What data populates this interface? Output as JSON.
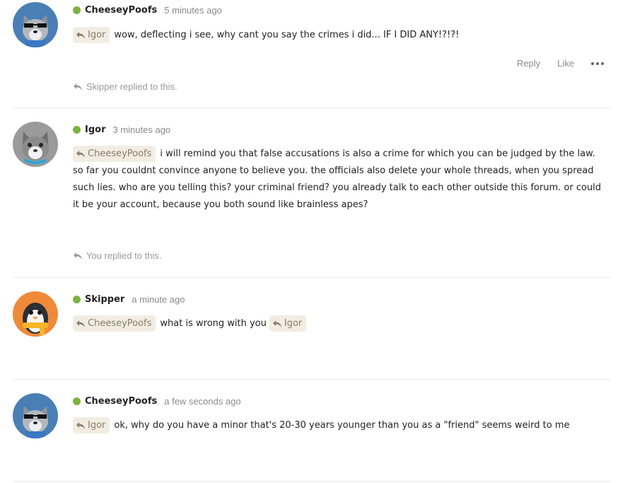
{
  "icons": {
    "reply": "reply-arrow-icon",
    "more": "more-dots-icon",
    "online": "online-status-dot"
  },
  "colors": {
    "online": "#7cb342",
    "chip_bg": "#f2ede3",
    "chip_text": "#8a7d68"
  },
  "posts": [
    {
      "author": "CheeseyPoofs",
      "time": "5 minutes ago",
      "reply_to": "Igor",
      "text": "wow, deflecting i see, why cant you say the crimes i did... IF I DID ANY!?!?!",
      "actions": {
        "reply": "Reply",
        "like": "Like"
      },
      "replied_note": "Skipper replied to this."
    },
    {
      "author": "Igor",
      "time": "3 minutes ago",
      "reply_to": "CheeseyPoofs",
      "text": "i will remind you that false accusations is also a crime for which you can be judged by the law. so far you couldnt convince anyone to believe you. the officials also delete your whole threads, when you spread such lies. who are you telling this? your criminal friend? you already talk to each other outside this forum. or could it be your account, because you both sound like brainless apes?",
      "replied_note": "You replied to this."
    },
    {
      "author": "Skipper",
      "time": "a minute ago",
      "reply_to": "CheeseyPoofs",
      "text": "what is wrong with you",
      "mention_after": "Igor"
    },
    {
      "author": "CheeseyPoofs",
      "time": "a few seconds ago",
      "reply_to": "Igor",
      "text": "ok, why do you have a minor that's 20-30 years younger than you as a \"friend\" seems weird to me"
    }
  ]
}
